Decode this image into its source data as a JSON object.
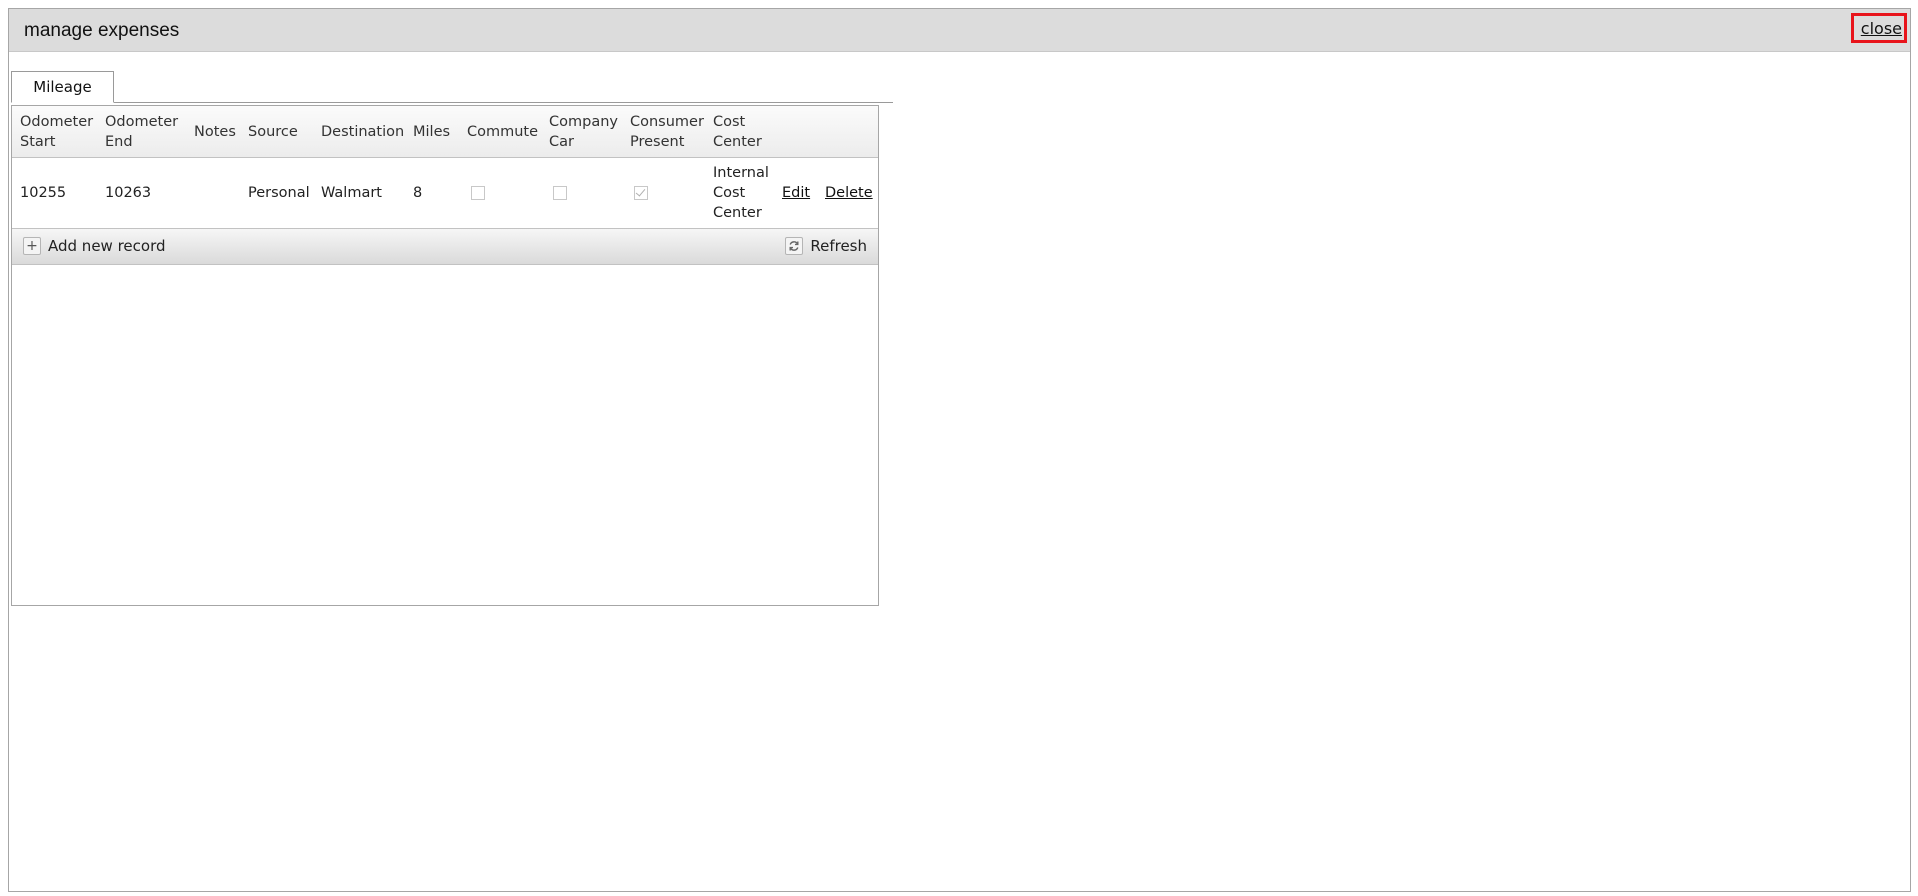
{
  "window": {
    "title": "manage expenses",
    "close_label": "close"
  },
  "tabs": [
    {
      "label": "Mileage",
      "selected": true
    }
  ],
  "grid": {
    "columns": [
      "Odometer\nStart",
      "Odometer\nEnd",
      "Notes",
      "Source",
      "Destination",
      "Miles",
      "Commute",
      "Company\nCar",
      "Consumer\nPresent",
      "Cost\nCenter"
    ],
    "rows": [
      {
        "odometer_start": "10255",
        "odometer_end": "10263",
        "notes": "",
        "source": "Personal",
        "destination": "Walmart",
        "miles": "8",
        "commute": false,
        "company_car": false,
        "consumer_present": true,
        "cost_center": "Internal\nCost\nCenter",
        "edit_label": "Edit",
        "delete_label": "Delete"
      }
    ],
    "toolbar": {
      "add_label": "Add new record",
      "add_icon": "plus-icon",
      "refresh_label": "Refresh",
      "refresh_icon": "refresh-icon"
    }
  },
  "colors": {
    "titlebar": "#dcdcdc",
    "close_highlight": "#e8141b"
  }
}
